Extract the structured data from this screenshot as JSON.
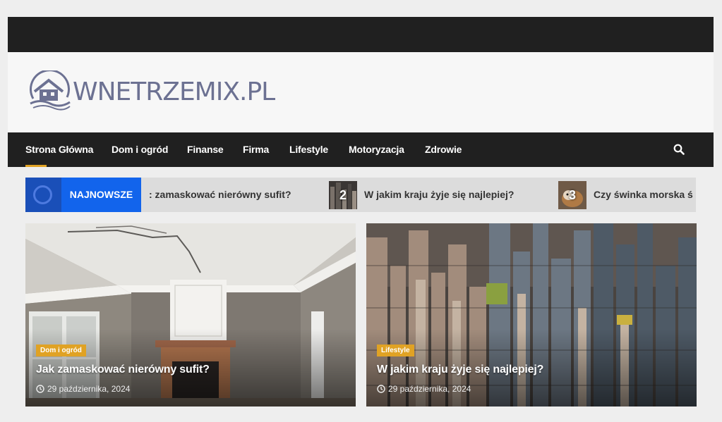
{
  "site": {
    "logo_text": "WNETRZEMIX.PL"
  },
  "nav": {
    "items": [
      "Strona Główna",
      "Dom i ogród",
      "Finanse",
      "Firma",
      "Lifestyle",
      "Motoryzacja",
      "Zdrowie"
    ],
    "active": "Strona Główna"
  },
  "ticker": {
    "label": "NAJNOWSZE",
    "items": [
      {
        "text": ": zamaskować nierówny sufit?"
      },
      {
        "number": "2",
        "text": "W jakim kraju żyje się najlepiej?"
      },
      {
        "number": "3",
        "text": "Czy świnka morska ś"
      }
    ]
  },
  "cards": [
    {
      "category": "Dom i ogród",
      "title": "Jak zamaskować nierówny sufit?",
      "date": "29 października, 2024"
    },
    {
      "category": "Lifestyle",
      "title": "W jakim kraju żyje się najlepiej?",
      "date": "29 października, 2024"
    }
  ],
  "colors": {
    "accent": "#e0a224",
    "ticker_blue": "#1264ec",
    "nav_bg": "#202020",
    "logo": "#6c7192"
  },
  "icons": [
    "house-logo-icon",
    "search-icon",
    "clock-icon"
  ]
}
